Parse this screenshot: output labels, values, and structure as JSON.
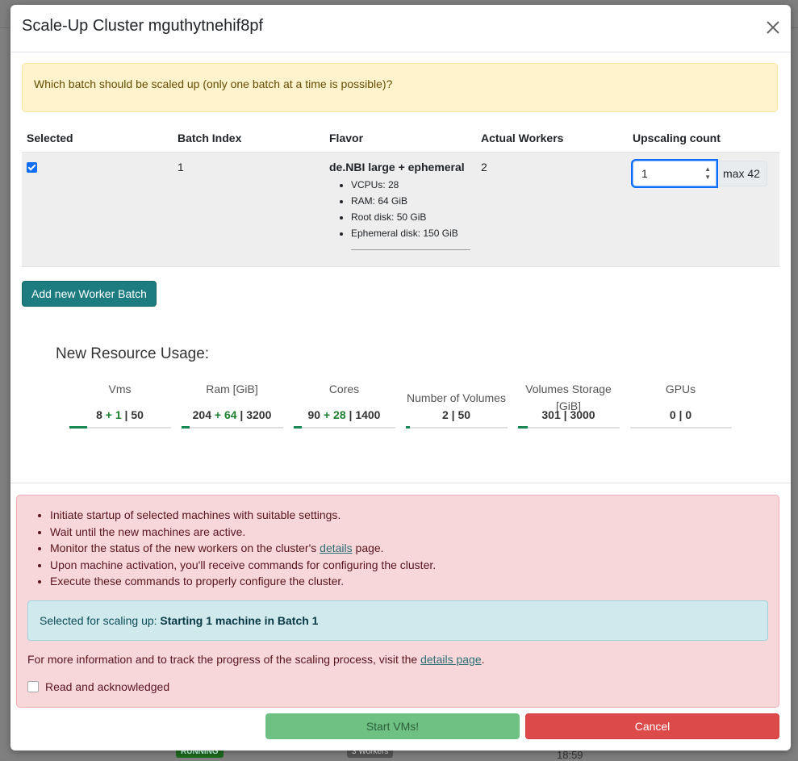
{
  "modal": {
    "title": "Scale-Up Cluster mguthytnehif8pf",
    "warning": "Which batch should be scaled up (only one batch at a time is possible)?"
  },
  "table": {
    "headers": [
      "Selected",
      "Batch Index",
      "Flavor",
      "Actual Workers",
      "Upscaling count"
    ],
    "row": {
      "selected": true,
      "batch_index": "1",
      "flavor_name": "de.NBI large + ephemeral",
      "flavor_specs": [
        "VCPUs: 28",
        "RAM: 64 GiB",
        "Root disk: 50 GiB",
        "Ephemeral disk: 150 GiB"
      ],
      "actual_workers": "2",
      "upscaling_count": "1",
      "max_label": "max 42"
    }
  },
  "add_batch_label": "Add new Worker Batch",
  "usage": {
    "title": "New Resource Usage:",
    "items": [
      {
        "label": "Vms",
        "current": "8",
        "plus": "+ 1",
        "limit": "| 50",
        "fill": 0.18
      },
      {
        "label": "Ram [GiB]",
        "current": "204",
        "plus": "+ 64",
        "limit": "| 3200",
        "fill": 0.08
      },
      {
        "label": "Cores",
        "current": "90",
        "plus": "+ 28",
        "limit": "| 1400",
        "fill": 0.08
      },
      {
        "label": "Number of Volumes",
        "current": "2",
        "plus": "",
        "limit": "| 50",
        "fill": 0.04
      },
      {
        "label": "Volumes Storage [GiB]",
        "current": "301",
        "plus": "",
        "limit": "| 3000",
        "fill": 0.1
      },
      {
        "label": "GPUs",
        "current": "0",
        "plus": "",
        "limit": "| 0",
        "fill": 0
      }
    ]
  },
  "info": {
    "steps": [
      "Initiate startup of selected machines with suitable settings.",
      "Wait until the new machines are active.",
      "Monitor the status of the new workers on the cluster's",
      "Upon machine activation, you'll receive commands for configuring the cluster.",
      "Execute these commands to properly configure the cluster."
    ],
    "details_link": "details",
    "step3_suffix": "page.",
    "selected_prefix": "Selected for scaling up: ",
    "selected_value": "Starting 1 machine in Batch 1",
    "more_info_prefix": "For more information and to track the progress of the scaling process, visit the",
    "more_info_link": "details page",
    "ack_label": "Read and acknowledged"
  },
  "buttons": {
    "start": "Start VMs!",
    "cancel": "Cancel"
  },
  "background": {
    "badge_running": "RUNNING",
    "badge_workers": "3 Workers",
    "time": "18:59"
  },
  "colors": {
    "teal": "#1c7c80",
    "success": "#198754",
    "danger": "#dc4a4a"
  }
}
